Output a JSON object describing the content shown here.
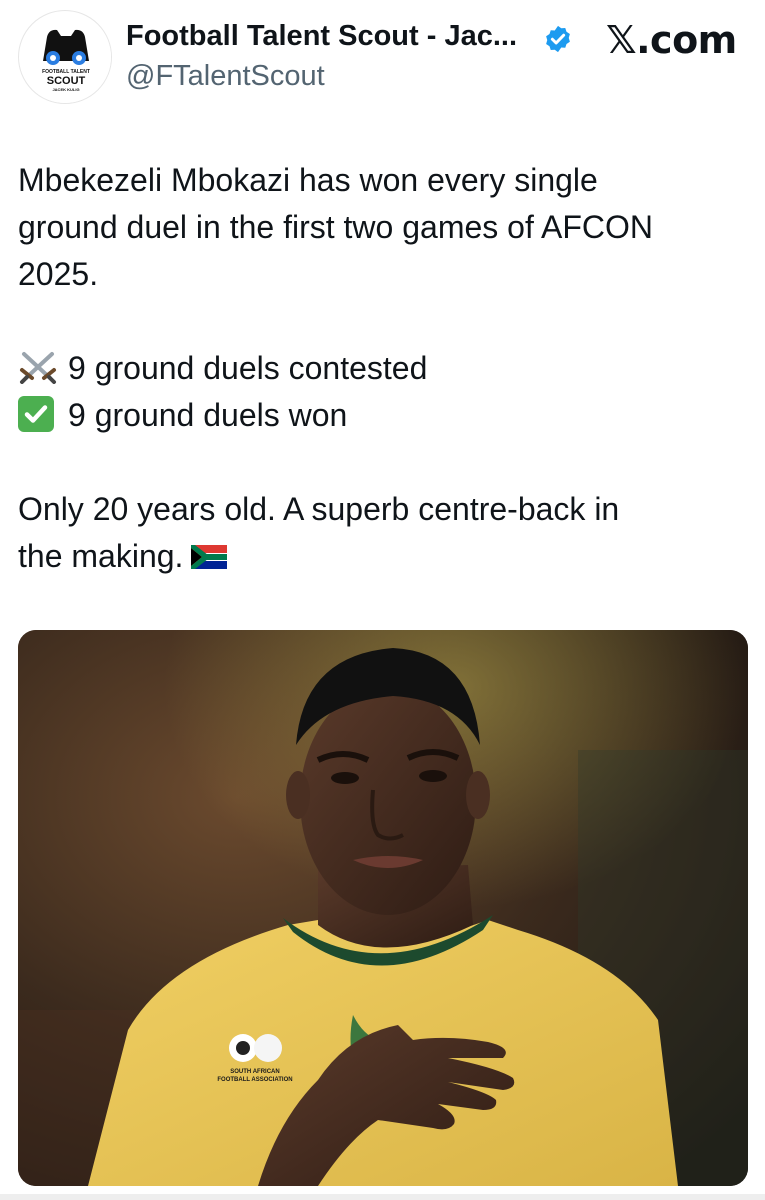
{
  "author": {
    "name": "Football Talent Scout - Jac...",
    "handle": "@FTalentScout",
    "avatar_text": [
      "FOOTBALL TALENT",
      "SCOUT",
      "JACEK KULIG"
    ],
    "verified": true
  },
  "source_label": "𝕏.com",
  "tweet": {
    "line1": "Mbekezeli Mbokazi has won every single",
    "line2": "ground duel in the first two games of AFCON",
    "line3": "2025.",
    "stat1_icon": "crossed-swords-icon",
    "stat1": "9 ground duels contested",
    "stat2_icon": "check-mark-button-icon",
    "stat2": "9 ground duels won",
    "line6": "Only 20 years old. A superb centre-back in",
    "line7": "the making.",
    "flag_icon": "south-africa-flag-icon"
  },
  "media": {
    "description_icon": "player-photo",
    "badge_text": [
      "SOUTH AFRICAN",
      "FOOTBALL ASSOCIATION"
    ]
  },
  "colors": {
    "text": "#0f1419",
    "secondary": "#536471",
    "verified": "#1d9bf0",
    "jersey": "#e9c558",
    "jersey_collar": "#1d4a2e"
  }
}
